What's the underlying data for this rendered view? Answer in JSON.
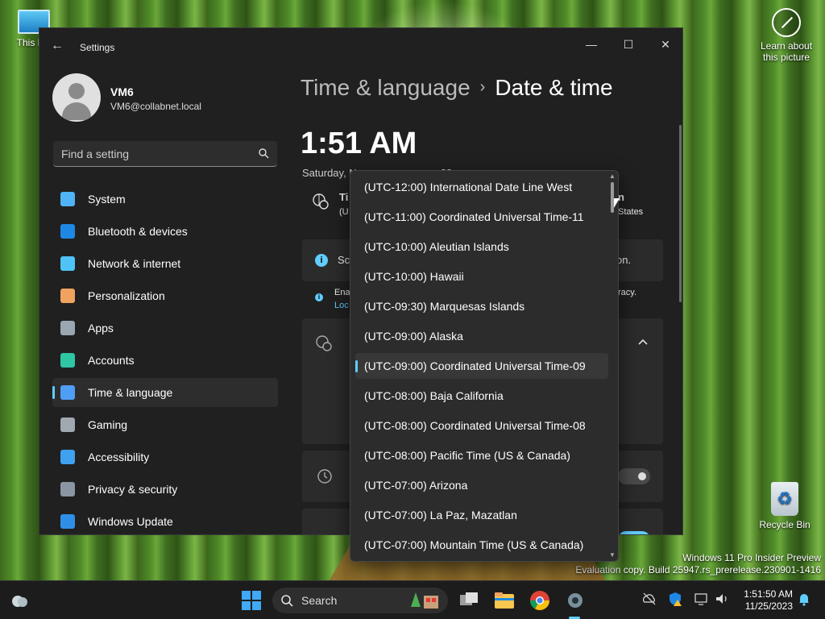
{
  "desktop": {
    "this_pc_label": "This PC",
    "recycle_bin_label": "Recycle Bin",
    "learn_label_line1": "Learn about",
    "learn_label_line2": "this picture",
    "watermark_line1": "Windows 11 Pro Insider Preview",
    "watermark_line2": "Evaluation copy. Build 25947.rs_prerelease.230901-1416"
  },
  "window": {
    "title": "Settings",
    "minimize_glyph": "—",
    "maximize_glyph": "☐",
    "close_glyph": "✕",
    "back_glyph": "←"
  },
  "profile": {
    "name": "VM6",
    "email": "VM6@collabnet.local"
  },
  "search": {
    "placeholder": "Find a setting"
  },
  "nav": {
    "items": [
      {
        "label": "System",
        "color": "#4fb3f6"
      },
      {
        "label": "Bluetooth & devices",
        "color": "#1e88e5"
      },
      {
        "label": "Network & internet",
        "color": "#4fc3f7"
      },
      {
        "label": "Personalization",
        "color": "#f0a35e"
      },
      {
        "label": "Apps",
        "color": "#9aa7b3"
      },
      {
        "label": "Accounts",
        "color": "#2fc6a4"
      },
      {
        "label": "Time & language",
        "color": "#4f9ef6"
      },
      {
        "label": "Gaming",
        "color": "#a0a8b0"
      },
      {
        "label": "Accessibility",
        "color": "#3fa0f0"
      },
      {
        "label": "Privacy & security",
        "color": "#8a96a3"
      },
      {
        "label": "Windows Update",
        "color": "#2f8fe6"
      }
    ],
    "active_index": 6
  },
  "main": {
    "breadcrumb_parent": "Time & language",
    "breadcrumb_separator": "›",
    "breadcrumb_current": "Date & time",
    "time": "1:51 AM",
    "date_fragment": "Saturday, N",
    "date_fragment_end": "23",
    "tz_card_frag1": "Ti",
    "tz_card_frag2": "(U",
    "tz_card_right1": "n",
    "tz_card_right2": "States",
    "notice_frag": "Sc",
    "notice_end": "on.",
    "loc_frag1": "Ena",
    "loc_frag2": "Loc",
    "loc_end": "racy."
  },
  "dropdown": {
    "options": [
      "(UTC-12:00) International Date Line West",
      "(UTC-11:00) Coordinated Universal Time-11",
      "(UTC-10:00) Aleutian Islands",
      "(UTC-10:00) Hawaii",
      "(UTC-09:30) Marquesas Islands",
      "(UTC-09:00) Alaska",
      "(UTC-09:00) Coordinated Universal Time-09",
      "(UTC-08:00) Baja California",
      "(UTC-08:00) Coordinated Universal Time-08",
      "(UTC-08:00) Pacific Time (US & Canada)",
      "(UTC-07:00) Arizona",
      "(UTC-07:00) La Paz, Mazatlan",
      "(UTC-07:00) Mountain Time (US & Canada)"
    ],
    "selected_index": 6,
    "scroll_up_glyph": "▲",
    "scroll_down_glyph": "▼"
  },
  "taskbar": {
    "search_label": "Search",
    "clock_time": "1:51:50 AM",
    "clock_date": "11/25/2023"
  },
  "colors": {
    "accent": "#60cdff",
    "window_bg": "#202020",
    "dropdown_bg": "#2c2c2c"
  }
}
